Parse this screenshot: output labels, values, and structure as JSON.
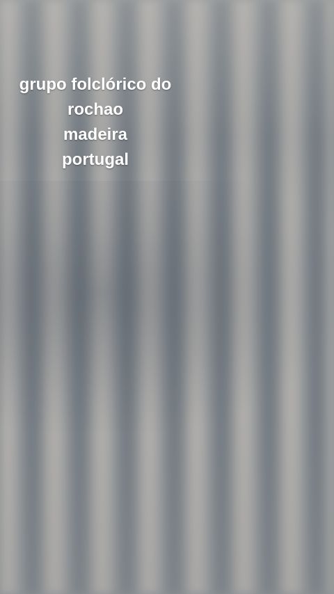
{
  "caption": {
    "line1": "grupo folclórico do",
    "line2": "rochao",
    "line3": "madeira",
    "line4": "portugal"
  }
}
